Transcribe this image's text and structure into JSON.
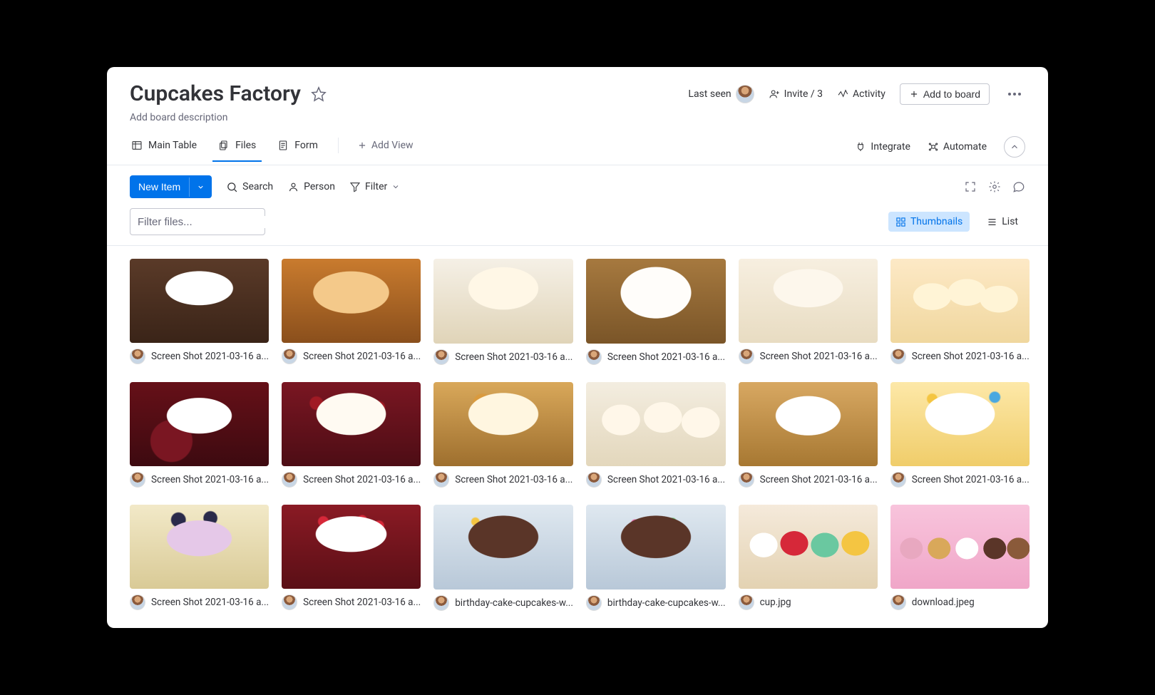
{
  "header": {
    "title": "Cupcakes Factory",
    "description_placeholder": "Add board description",
    "last_seen_label": "Last seen",
    "invite_label": "Invite / 3",
    "activity_label": "Activity",
    "add_to_board_label": "Add to board"
  },
  "views": {
    "tabs": [
      {
        "label": "Main Table"
      },
      {
        "label": "Files"
      },
      {
        "label": "Form"
      }
    ],
    "add_view_label": "Add View",
    "integrate_label": "Integrate",
    "automate_label": "Automate"
  },
  "toolbar": {
    "new_item_label": "New Item",
    "search_label": "Search",
    "person_label": "Person",
    "filter_label": "Filter"
  },
  "files_controls": {
    "filter_placeholder": "Filter files...",
    "thumbnails_label": "Thumbnails",
    "list_label": "List"
  },
  "files": [
    {
      "name": "Screen Shot 2021-03-16 a...",
      "thumb_class": "cupcake-a"
    },
    {
      "name": "Screen Shot 2021-03-16 a...",
      "thumb_class": "cupcake-b"
    },
    {
      "name": "Screen Shot 2021-03-16 a...",
      "thumb_class": "cupcake-c"
    },
    {
      "name": "Screen Shot 2021-03-16 a...",
      "thumb_class": "cupcake-d"
    },
    {
      "name": "Screen Shot 2021-03-16 a...",
      "thumb_class": "cupcake-e"
    },
    {
      "name": "Screen Shot 2021-03-16 a...",
      "thumb_class": "cupcake-f"
    },
    {
      "name": "Screen Shot 2021-03-16 a...",
      "thumb_class": "cupcake-g"
    },
    {
      "name": "Screen Shot 2021-03-16 a...",
      "thumb_class": "cupcake-h"
    },
    {
      "name": "Screen Shot 2021-03-16 a...",
      "thumb_class": "cupcake-i"
    },
    {
      "name": "Screen Shot 2021-03-16 a...",
      "thumb_class": "cupcake-j"
    },
    {
      "name": "Screen Shot 2021-03-16 a...",
      "thumb_class": "cupcake-k"
    },
    {
      "name": "Screen Shot 2021-03-16 a...",
      "thumb_class": "cupcake-l"
    },
    {
      "name": "Screen Shot 2021-03-16 a...",
      "thumb_class": "cupcake-m"
    },
    {
      "name": "Screen Shot 2021-03-16 a...",
      "thumb_class": "cupcake-n"
    },
    {
      "name": "birthday-cake-cupcakes-w...",
      "thumb_class": "cupcake-o"
    },
    {
      "name": "birthday-cake-cupcakes-w...",
      "thumb_class": "cupcake-p"
    },
    {
      "name": "cup.jpg",
      "thumb_class": "cupcake-q"
    },
    {
      "name": "download.jpeg",
      "thumb_class": "cupcake-r"
    }
  ]
}
